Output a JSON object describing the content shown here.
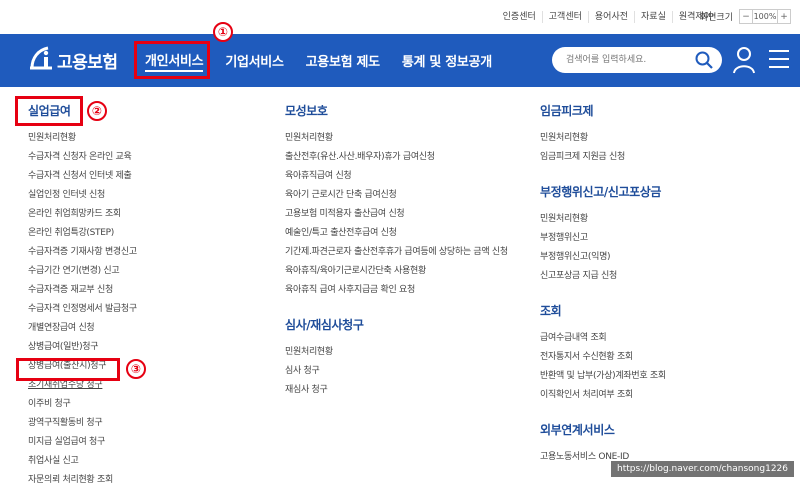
{
  "utility": {
    "links": [
      "인증센터",
      "고객센터",
      "용어사전",
      "자료실",
      "원격제어"
    ],
    "zoom_label": "화면크기",
    "zoom_minus": "−",
    "zoom_value": "100%",
    "zoom_plus": "+"
  },
  "nav": {
    "logo_text": "고용보험",
    "menu": [
      "개인서비스",
      "기업서비스",
      "고용보험 제도",
      "통계 및 정보공개"
    ],
    "search_placeholder": "검색어를 입력하세요."
  },
  "annotations": [
    "①",
    "②",
    "③"
  ],
  "col1": {
    "title": "실업급여",
    "items": [
      "민원처리현황",
      "수급자격 신청자 온라인 교육",
      "수급자격 신청서 인터넷 제출",
      "실업인정 인터넷 신청",
      "온라인 취업희망카드 조회",
      "온라인 취업특강(STEP)",
      "수급자격증 기재사항 변경신고",
      "수급기간 연기(변경) 신고",
      "수급자격증 재교부 신청",
      "수급자격 인정명세서 발급청구",
      "개별연장급여 신청",
      "상병급여(일반)청구",
      "상병급여(출산시)청구",
      "조기재취업수당 청구",
      "이주비 청구",
      "광역구직활동비 청구",
      "미지급 실업급여 청구",
      "취업사실 신고",
      "자문의뢰 처리현황 조회"
    ]
  },
  "col2": {
    "title": "모성보호",
    "items": [
      "민원처리현황",
      "출산전후(유산.사산.배우자)휴가 급여신청",
      "육아휴직급여 신청",
      "육아기 근로시간 단축 급여신청",
      "고용보험 미적용자 출산급여 신청",
      "예술인/특고 출산전후급여 신청",
      "기간제.파견근로자 출산전후휴가 급여등에 상당하는 금액 신청",
      "육아휴직/육아기근로시간단축 사용현황",
      "육아휴직 급여 사후지급금 확인 요청"
    ],
    "title2": "심사/재심사청구",
    "items2": [
      "민원처리현황",
      "심사 청구",
      "재심사 청구"
    ]
  },
  "col3": {
    "title": "임금피크제",
    "items": [
      "민원처리현황",
      "임금피크제 지원금 신청"
    ],
    "title2": "부정행위신고/신고포상금",
    "items2": [
      "민원처리현황",
      "부정행위신고",
      "부정행위신고(익명)",
      "신고포상금 지급 신청"
    ],
    "title3": "조회",
    "items3": [
      "급여수급내역 조회",
      "전자통지서 수신현황 조회",
      "반환액 및 납부(가상)계좌번호 조회",
      "이직확인서 처리여부 조회"
    ],
    "title4": "외부연계서비스",
    "items4": [
      "고용노동서비스 ONE-ID"
    ]
  },
  "watermark": "https://blog.naver.com/chansong1226",
  "colors": {
    "nav_bg": "#1f5bbd",
    "title_blue": "#1f4d9a",
    "annotation_red": "#e60012"
  }
}
